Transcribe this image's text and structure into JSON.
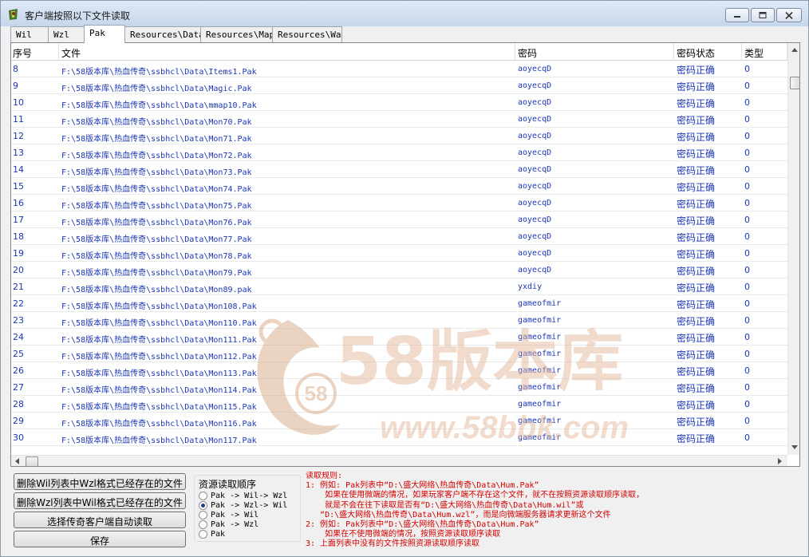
{
  "window": {
    "title": "客户端按照以下文件读取"
  },
  "tabs": [
    {
      "label": "Wil"
    },
    {
      "label": "Wzl"
    },
    {
      "label": "Pak",
      "active": true
    },
    {
      "label": "Resources\\Data"
    },
    {
      "label": "Resources\\Map"
    },
    {
      "label": "Resources\\Wav"
    }
  ],
  "table": {
    "columns": [
      "序号",
      "文件",
      "密码",
      "密码状态",
      "类型"
    ],
    "rows": [
      [
        "8",
        "F:\\58版本库\\热血传奇\\ssbhcl\\Data\\Items1.Pak",
        "aoyecqD",
        "密码正确",
        "0"
      ],
      [
        "9",
        "F:\\58版本库\\热血传奇\\ssbhcl\\Data\\Magic.Pak",
        "aoyecqD",
        "密码正确",
        "0"
      ],
      [
        "10",
        "F:\\58版本库\\热血传奇\\ssbhcl\\Data\\mmap10.Pak",
        "aoyecqD",
        "密码正确",
        "0"
      ],
      [
        "11",
        "F:\\58版本库\\热血传奇\\ssbhcl\\Data\\Mon70.Pak",
        "aoyecqD",
        "密码正确",
        "0"
      ],
      [
        "12",
        "F:\\58版本库\\热血传奇\\ssbhcl\\Data\\Mon71.Pak",
        "aoyecqD",
        "密码正确",
        "0"
      ],
      [
        "13",
        "F:\\58版本库\\热血传奇\\ssbhcl\\Data\\Mon72.Pak",
        "aoyecqD",
        "密码正确",
        "0"
      ],
      [
        "14",
        "F:\\58版本库\\热血传奇\\ssbhcl\\Data\\Mon73.Pak",
        "aoyecqD",
        "密码正确",
        "0"
      ],
      [
        "15",
        "F:\\58版本库\\热血传奇\\ssbhcl\\Data\\Mon74.Pak",
        "aoyecqD",
        "密码正确",
        "0"
      ],
      [
        "16",
        "F:\\58版本库\\热血传奇\\ssbhcl\\Data\\Mon75.Pak",
        "aoyecqD",
        "密码正确",
        "0"
      ],
      [
        "17",
        "F:\\58版本库\\热血传奇\\ssbhcl\\Data\\Mon76.Pak",
        "aoyecqD",
        "密码正确",
        "0"
      ],
      [
        "18",
        "F:\\58版本库\\热血传奇\\ssbhcl\\Data\\Mon77.Pak",
        "aoyecqD",
        "密码正确",
        "0"
      ],
      [
        "19",
        "F:\\58版本库\\热血传奇\\ssbhcl\\Data\\Mon78.Pak",
        "aoyecqD",
        "密码正确",
        "0"
      ],
      [
        "20",
        "F:\\58版本库\\热血传奇\\ssbhcl\\Data\\Mon79.Pak",
        "aoyecqD",
        "密码正确",
        "0"
      ],
      [
        "21",
        "F:\\58版本库\\热血传奇\\ssbhcl\\Data\\Mon89.pak",
        "yxdiy",
        "密码正确",
        "0"
      ],
      [
        "22",
        "F:\\58版本库\\热血传奇\\ssbhcl\\Data\\Mon108.Pak",
        "gameofmir",
        "密码正确",
        "0"
      ],
      [
        "23",
        "F:\\58版本库\\热血传奇\\ssbhcl\\Data\\Mon110.Pak",
        "gameofmir",
        "密码正确",
        "0"
      ],
      [
        "24",
        "F:\\58版本库\\热血传奇\\ssbhcl\\Data\\Mon111.Pak",
        "gameofmir",
        "密码正确",
        "0"
      ],
      [
        "25",
        "F:\\58版本库\\热血传奇\\ssbhcl\\Data\\Mon112.Pak",
        "gameofmir",
        "密码正确",
        "0"
      ],
      [
        "26",
        "F:\\58版本库\\热血传奇\\ssbhcl\\Data\\Mon113.Pak",
        "gameofmir",
        "密码正确",
        "0"
      ],
      [
        "27",
        "F:\\58版本库\\热血传奇\\ssbhcl\\Data\\Mon114.Pak",
        "gameofmir",
        "密码正确",
        "0"
      ],
      [
        "28",
        "F:\\58版本库\\热血传奇\\ssbhcl\\Data\\Mon115.Pak",
        "gameofmir",
        "密码正确",
        "0"
      ],
      [
        "29",
        "F:\\58版本库\\热血传奇\\ssbhcl\\Data\\Mon116.Pak",
        "gameofmir",
        "密码正确",
        "0"
      ],
      [
        "30",
        "F:\\58版本库\\热血传奇\\ssbhcl\\Data\\Mon117.Pak",
        "gameofmir",
        "密码正确",
        "0"
      ]
    ]
  },
  "buttons": {
    "delete_wil": "删除Wil列表中Wzl格式已经存在的文件",
    "delete_wzl": "删除Wzl列表中Wil格式已经存在的文件",
    "auto_read": "选择传奇客户端自动读取",
    "save": "保存"
  },
  "order_group": {
    "title": "资源读取顺序",
    "options": [
      {
        "label": "Pak -> Wil-> Wzl",
        "selected": false
      },
      {
        "label": "Pak -> Wzl-> Wil",
        "selected": true
      },
      {
        "label": "Pak -> Wil",
        "selected": false
      },
      {
        "label": "Pak -> Wzl",
        "selected": false
      },
      {
        "label": "Pak",
        "selected": false
      }
    ]
  },
  "rules": {
    "lines": [
      "读取规则:",
      "1: 例如: Pak列表中“D:\\盛大网络\\热血传奇\\Data\\Hum.Pak”",
      "    如果在使用微端的情况，如果玩家客户端不存在这个文件，就不在按照资源读取顺序读取，",
      "    就是不会在往下读取是否有“D:\\盛大网络\\热血传奇\\Data\\Hum.wil”或",
      "   “D:\\盛大网络\\热血传奇\\Data\\Hum.wzl”，而是向微端服务器请求更新这个文件",
      "2: 例如: Pak列表中“D:\\盛大网络\\热血传奇\\Data\\Hum.Pak”",
      "    如果在不使用微端的情况，按照资源读取顺序读取",
      "3: 上面列表中没有的文件按照资源读取顺序读取"
    ]
  },
  "watermark": {
    "brand": "58版本库",
    "url": "www.58bbk.com",
    "badge": "58"
  },
  "colors": {
    "row_text": "#1c36b5",
    "rules_text": "#d40000",
    "watermark": "#e8c7b4"
  }
}
